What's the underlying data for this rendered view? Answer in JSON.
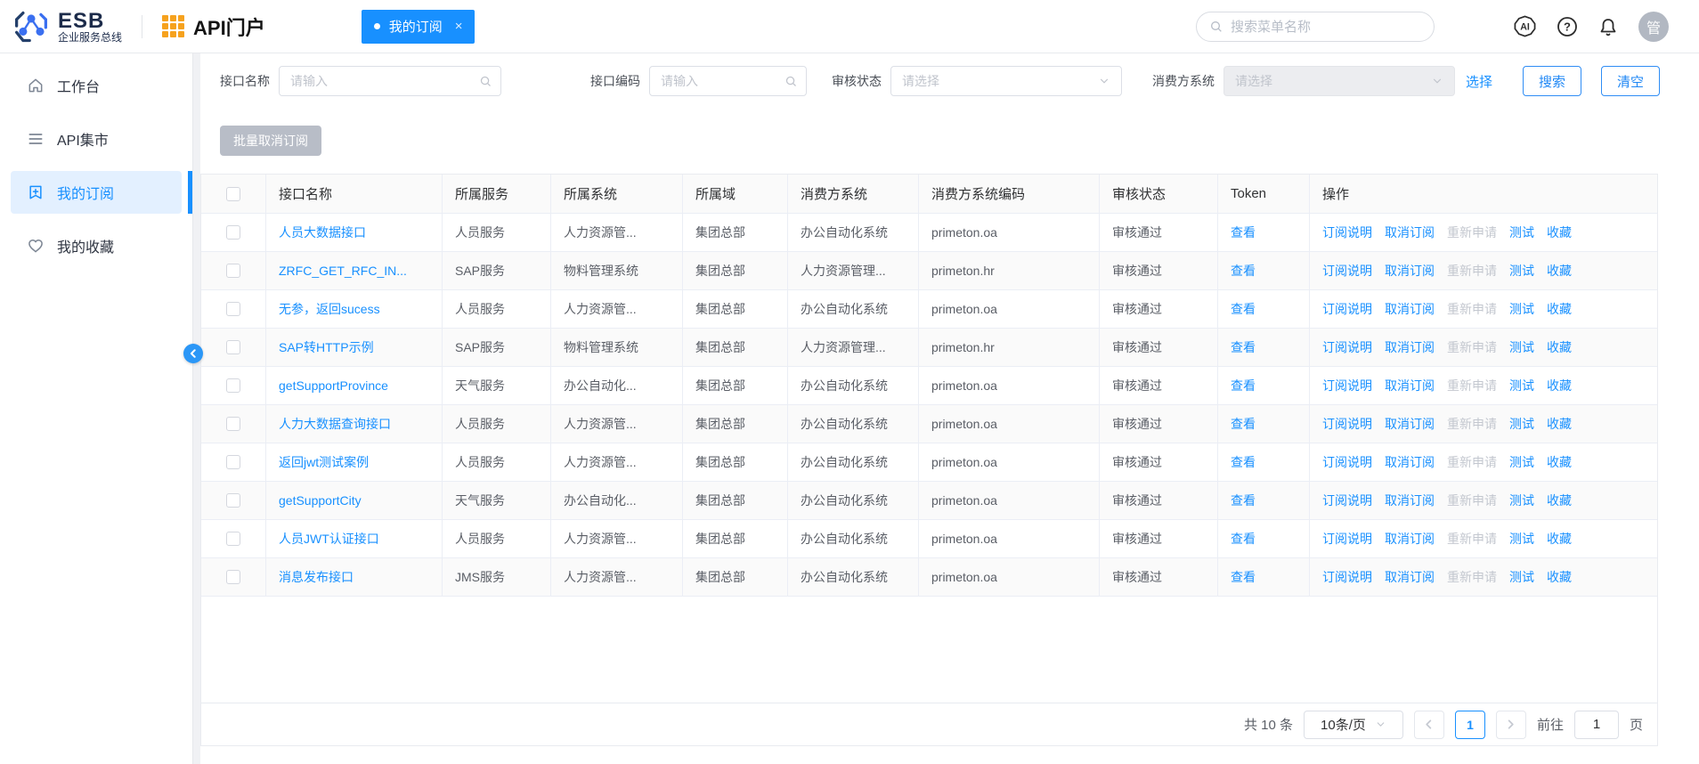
{
  "topbar": {
    "logo_title": "ESB",
    "logo_subtitle": "企业服务总线",
    "portal_title": "API门户",
    "tab_label": "我的订阅",
    "tab_close": "×",
    "search_placeholder": "搜索菜单名称",
    "avatar_text": "管"
  },
  "sidebar": {
    "items": [
      {
        "label": "工作台",
        "icon": "home-icon",
        "active": false
      },
      {
        "label": "API集市",
        "icon": "list-icon",
        "active": false
      },
      {
        "label": "我的订阅",
        "icon": "bookmark-plus-icon",
        "active": true
      },
      {
        "label": "我的收藏",
        "icon": "heart-icon",
        "active": false
      }
    ]
  },
  "filters": {
    "name_label": "接口名称",
    "name_placeholder": "请输入",
    "code_label": "接口编码",
    "code_placeholder": "请输入",
    "status_label": "审核状态",
    "status_placeholder": "请选择",
    "consumer_label": "消费方系统",
    "consumer_placeholder": "请选择",
    "select_link": "选择",
    "search_button": "搜索",
    "clear_button": "清空"
  },
  "toolbar": {
    "batch_unsubscribe": "批量取消订阅"
  },
  "table": {
    "headers": [
      "接口名称",
      "所属服务",
      "所属系统",
      "所属域",
      "消费方系统",
      "消费方系统编码",
      "审核状态",
      "Token",
      "操作"
    ],
    "token_link": "查看",
    "actions": {
      "desc": "订阅说明",
      "cancel": "取消订阅",
      "reapply": "重新申请",
      "test": "测试",
      "favorite": "收藏"
    },
    "rows": [
      {
        "name": "人员大数据接口",
        "service": "人员服务",
        "system": "人力资源管...",
        "domain": "集团总部",
        "consumer": "办公自动化系统",
        "consumer_code": "primeton.oa",
        "status": "审核通过"
      },
      {
        "name": "ZRFC_GET_RFC_IN...",
        "service": "SAP服务",
        "system": "物料管理系统",
        "domain": "集团总部",
        "consumer": "人力资源管理...",
        "consumer_code": "primeton.hr",
        "status": "审核通过"
      },
      {
        "name": "无参，返回sucess",
        "service": "人员服务",
        "system": "人力资源管...",
        "domain": "集团总部",
        "consumer": "办公自动化系统",
        "consumer_code": "primeton.oa",
        "status": "审核通过"
      },
      {
        "name": "SAP转HTTP示例",
        "service": "SAP服务",
        "system": "物料管理系统",
        "domain": "集团总部",
        "consumer": "人力资源管理...",
        "consumer_code": "primeton.hr",
        "status": "审核通过"
      },
      {
        "name": "getSupportProvince",
        "service": "天气服务",
        "system": "办公自动化...",
        "domain": "集团总部",
        "consumer": "办公自动化系统",
        "consumer_code": "primeton.oa",
        "status": "审核通过"
      },
      {
        "name": "人力大数据查询接口",
        "service": "人员服务",
        "system": "人力资源管...",
        "domain": "集团总部",
        "consumer": "办公自动化系统",
        "consumer_code": "primeton.oa",
        "status": "审核通过"
      },
      {
        "name": "返回jwt测试案例",
        "service": "人员服务",
        "system": "人力资源管...",
        "domain": "集团总部",
        "consumer": "办公自动化系统",
        "consumer_code": "primeton.oa",
        "status": "审核通过"
      },
      {
        "name": "getSupportCity",
        "service": "天气服务",
        "system": "办公自动化...",
        "domain": "集团总部",
        "consumer": "办公自动化系统",
        "consumer_code": "primeton.oa",
        "status": "审核通过"
      },
      {
        "name": "人员JWT认证接口",
        "service": "人员服务",
        "system": "人力资源管...",
        "domain": "集团总部",
        "consumer": "办公自动化系统",
        "consumer_code": "primeton.oa",
        "status": "审核通过"
      },
      {
        "name": "消息发布接口",
        "service": "JMS服务",
        "system": "人力资源管...",
        "domain": "集团总部",
        "consumer": "办公自动化系统",
        "consumer_code": "primeton.oa",
        "status": "审核通过"
      }
    ]
  },
  "pagination": {
    "total_text": "共 10 条",
    "page_size": "10条/页",
    "current_page": "1",
    "goto_label": "前往",
    "goto_value": "1",
    "page_suffix": "页"
  },
  "colors": {
    "primary": "#1890ff",
    "tab_background": "#1890ff",
    "grid_icon_orange": "#f6a21e",
    "logo_navy": "#1c2b4a",
    "disabled_link": "#c3c7cf",
    "disabled_button": "#b8bdc7",
    "active_item_background": "#e3f0ff"
  }
}
